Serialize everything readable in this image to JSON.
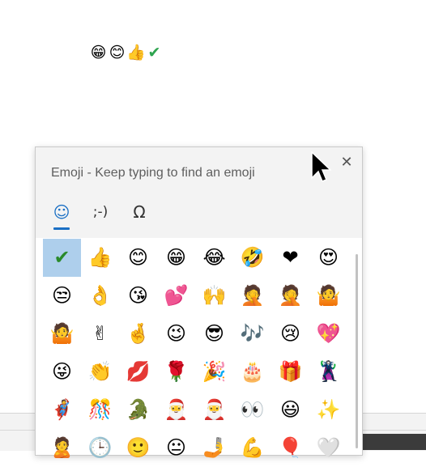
{
  "document": {
    "typed_emojis": [
      "😁",
      "😊",
      "👍",
      "✔"
    ]
  },
  "emoji_panel": {
    "title": "Emoji - Keep typing to find an emoji",
    "close_symbol": "✕",
    "tabs": [
      {
        "label": "☺",
        "name": "emoji",
        "active": true
      },
      {
        "label": ";-)",
        "name": "kaomoji",
        "active": false
      },
      {
        "label": "Ω",
        "name": "symbols",
        "active": false
      }
    ],
    "emojis": [
      "✔",
      "👍",
      "😊",
      "😁",
      "😂",
      "🤣",
      "❤",
      "😍",
      "😒",
      "👌",
      "😘",
      "💕",
      "🙌",
      "🤦",
      "🤦",
      "🤷",
      "🤷",
      "✌",
      "🤞",
      "😉",
      "😎",
      "🎶",
      "😢",
      "💖",
      "😜",
      "👏",
      "💋",
      "🌹",
      "🎉",
      "🎂",
      "🎁",
      "🦹",
      "🦸",
      "🎊",
      "🐊",
      "🎅",
      "🎅",
      "👀",
      "😃",
      "✨",
      "🙎",
      "🕒",
      "🙂",
      "😐",
      "🤳",
      "💪",
      "🎈",
      "🤍"
    ],
    "selected_index": 0,
    "accent_color": "#1a6fc4",
    "selection_color": "#aecfec"
  }
}
